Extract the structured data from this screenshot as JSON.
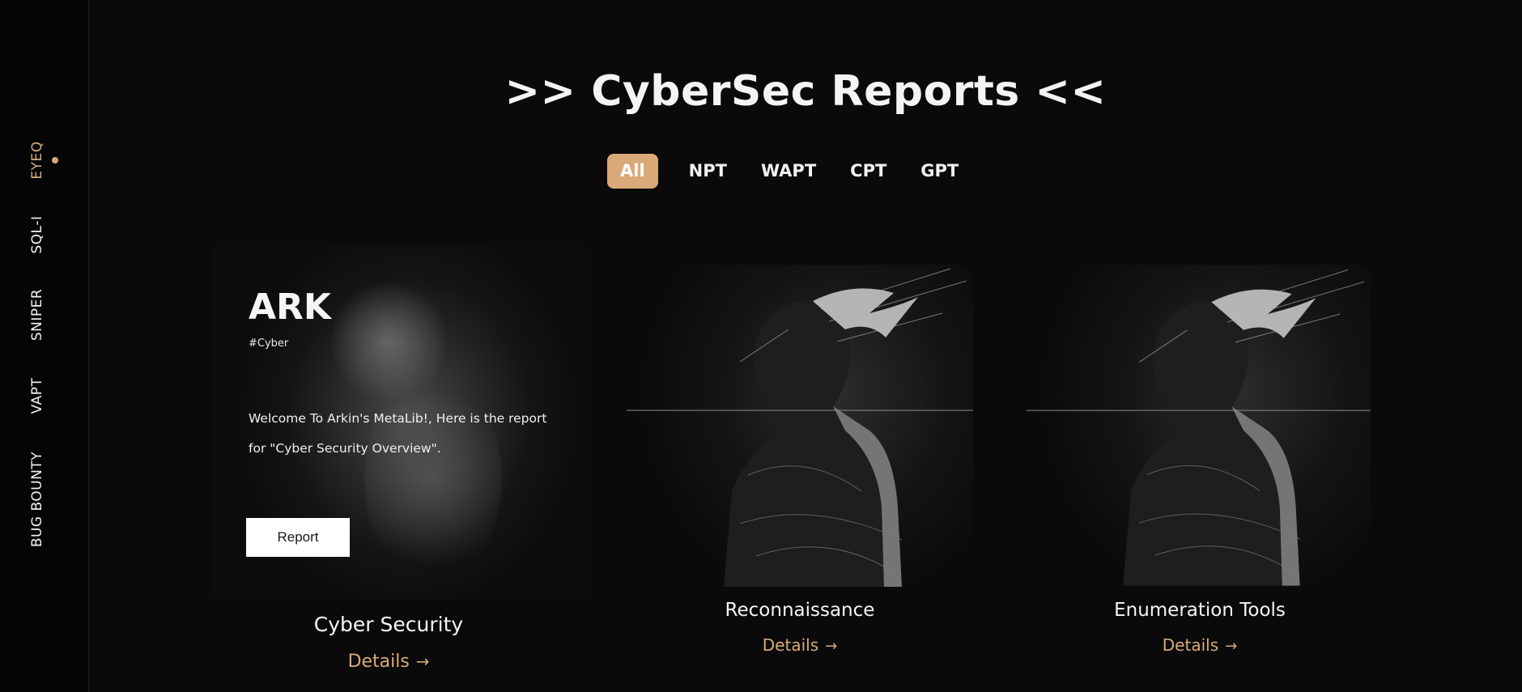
{
  "sidebar": {
    "items": [
      {
        "label": "EYEQ",
        "active": true
      },
      {
        "label": "SQL-I"
      },
      {
        "label": "SNIPER"
      },
      {
        "label": "VAPT"
      },
      {
        "label": "BUG BOUNTY"
      }
    ]
  },
  "page": {
    "title": ">> CyberSec Reports <<"
  },
  "filters": [
    {
      "label": "All",
      "active": true
    },
    {
      "label": "NPT"
    },
    {
      "label": "WAPT"
    },
    {
      "label": "CPT"
    },
    {
      "label": "GPT"
    }
  ],
  "featured": {
    "title": "ARK",
    "tag": "#Cyber",
    "description": "Welcome To Arkin's MetaLib!, Here is the report for \"Cyber Security Overview\".",
    "button_label": "Report",
    "name": "Cyber Security",
    "details_label": "Details"
  },
  "cards": [
    {
      "name": "Reconnaissance",
      "details_label": "Details"
    },
    {
      "name": "Enumeration Tools",
      "details_label": "Details"
    }
  ],
  "icons": {
    "arrow": "arrow-right-icon",
    "dot": "active-dot-icon"
  },
  "colors": {
    "accent": "#d9aa78",
    "background": "#0a0a0a",
    "sidebar": "#050505"
  }
}
